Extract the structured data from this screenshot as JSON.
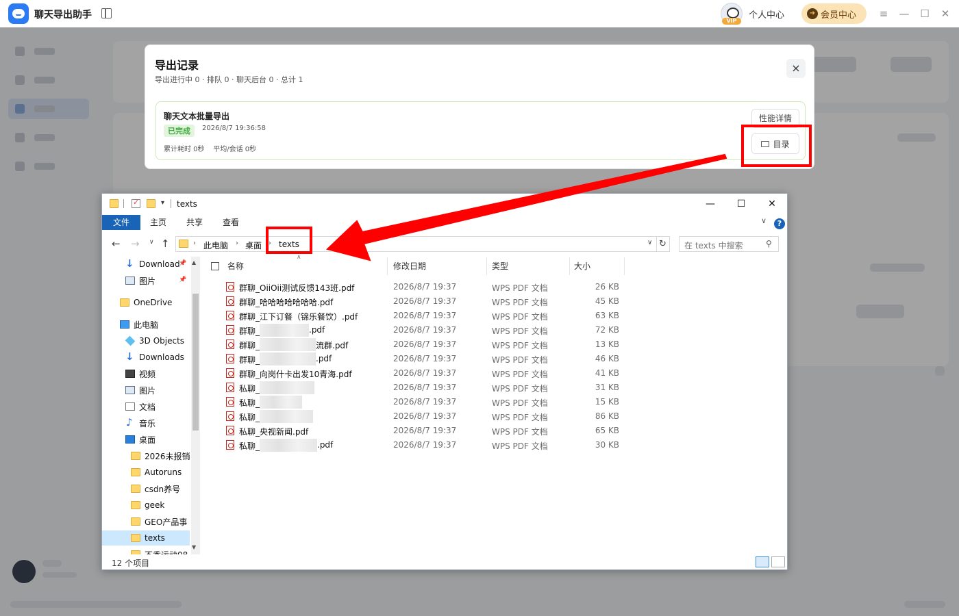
{
  "app": {
    "title": "聊天导出助手",
    "personal_center": "个人中心",
    "member_center": "会员中心",
    "vip_tag": "VIP",
    "win_controls": [
      "≡",
      "—",
      "☐",
      "✕"
    ]
  },
  "export_dialog": {
    "title": "导出记录",
    "stats": "导出进行中 0 · 排队 0 · 聊天后台 0 · 总计 1",
    "close_label": "×",
    "task": {
      "title": "聊天文本批量导出",
      "status": "已完成",
      "timestamp": "2026/8/7 19:36:58",
      "metrics": "累计耗时 0秒    平均/会话 0秒",
      "perf_button": "性能详情",
      "dir_button": "目录"
    }
  },
  "explorer": {
    "title": "texts",
    "window_controls": [
      "—",
      "☐",
      "✕"
    ],
    "ribbon_tabs": [
      "文件",
      "主页",
      "共享",
      "查看"
    ],
    "help": "?",
    "breadcrumb": [
      "此电脑",
      "桌面",
      "texts"
    ],
    "search_placeholder": "在 texts 中搜索",
    "nav_items": [
      {
        "label": "Download",
        "icon": "download-icon",
        "pinned": true
      },
      {
        "label": "图片",
        "icon": "pictures-icon",
        "pinned": true
      },
      {
        "label": "OneDrive",
        "icon": "folder-icon"
      },
      {
        "label": "此电脑",
        "icon": "computer-icon"
      },
      {
        "label": "3D Objects",
        "icon": "3d-objects-icon"
      },
      {
        "label": "Downloads",
        "icon": "download-icon"
      },
      {
        "label": "视频",
        "icon": "video-icon"
      },
      {
        "label": "图片",
        "icon": "pictures-icon"
      },
      {
        "label": "文档",
        "icon": "document-icon"
      },
      {
        "label": "音乐",
        "icon": "music-icon"
      },
      {
        "label": "桌面",
        "icon": "desktop-icon"
      },
      {
        "label": "2026未报销",
        "icon": "folder-icon"
      },
      {
        "label": "Autoruns",
        "icon": "folder-icon"
      },
      {
        "label": "csdn养号",
        "icon": "folder-icon"
      },
      {
        "label": "geek",
        "icon": "folder-icon"
      },
      {
        "label": "GEO产品事",
        "icon": "folder-icon"
      },
      {
        "label": "texts",
        "icon": "folder-icon",
        "selected": true
      },
      {
        "label": "不香运动08",
        "icon": "folder-icon"
      }
    ],
    "columns": [
      "名称",
      "修改日期",
      "类型",
      "大小"
    ],
    "files": [
      {
        "name": "群聊_OiiOii测试反馈143班.pdf",
        "date": "2026/8/7 19:37",
        "type": "WPS PDF 文档",
        "size": "26 KB"
      },
      {
        "name": "群聊_哈哈哈哈哈哈哈.pdf",
        "date": "2026/8/7 19:37",
        "type": "WPS PDF 文档",
        "size": "45 KB"
      },
      {
        "name": "群聊_江下订餐（锦乐餐饮）.pdf",
        "date": "2026/8/7 19:37",
        "type": "WPS PDF 文档",
        "size": "63 KB"
      },
      {
        "name": "群聊_",
        "suffix": ".pdf",
        "date": "2026/8/7 19:37",
        "type": "WPS PDF 文档",
        "size": "72 KB"
      },
      {
        "name": "群聊_",
        "suffix": "流群.pdf",
        "date": "2026/8/7 19:37",
        "type": "WPS PDF 文档",
        "size": "13 KB"
      },
      {
        "name": "群聊_",
        "suffix": ".pdf",
        "date": "2026/8/7 19:37",
        "type": "WPS PDF 文档",
        "size": "46 KB"
      },
      {
        "name": "群聊_向岗什卡出发10青海.pdf",
        "date": "2026/8/7 19:37",
        "type": "WPS PDF 文档",
        "size": "41 KB"
      },
      {
        "name": "私聊_",
        "suffix": "",
        "date": "2026/8/7 19:37",
        "type": "WPS PDF 文档",
        "size": "31 KB"
      },
      {
        "name": "私聊_",
        "suffix": "",
        "date": "2026/8/7 19:37",
        "type": "WPS PDF 文档",
        "size": "15 KB"
      },
      {
        "name": "私聊_",
        "suffix": "",
        "date": "2026/8/7 19:37",
        "type": "WPS PDF 文档",
        "size": "86 KB"
      },
      {
        "name": "私聊_央视新闻.pdf",
        "date": "2026/8/7 19:37",
        "type": "WPS PDF 文档",
        "size": "65 KB"
      },
      {
        "name": "私聊_",
        "suffix": ".pdf",
        "date": "2026/8/7 19:37",
        "type": "WPS PDF 文档",
        "size": "30 KB"
      }
    ],
    "status_text": "12 个项目"
  },
  "annotation": {
    "color": "#ff0000"
  }
}
